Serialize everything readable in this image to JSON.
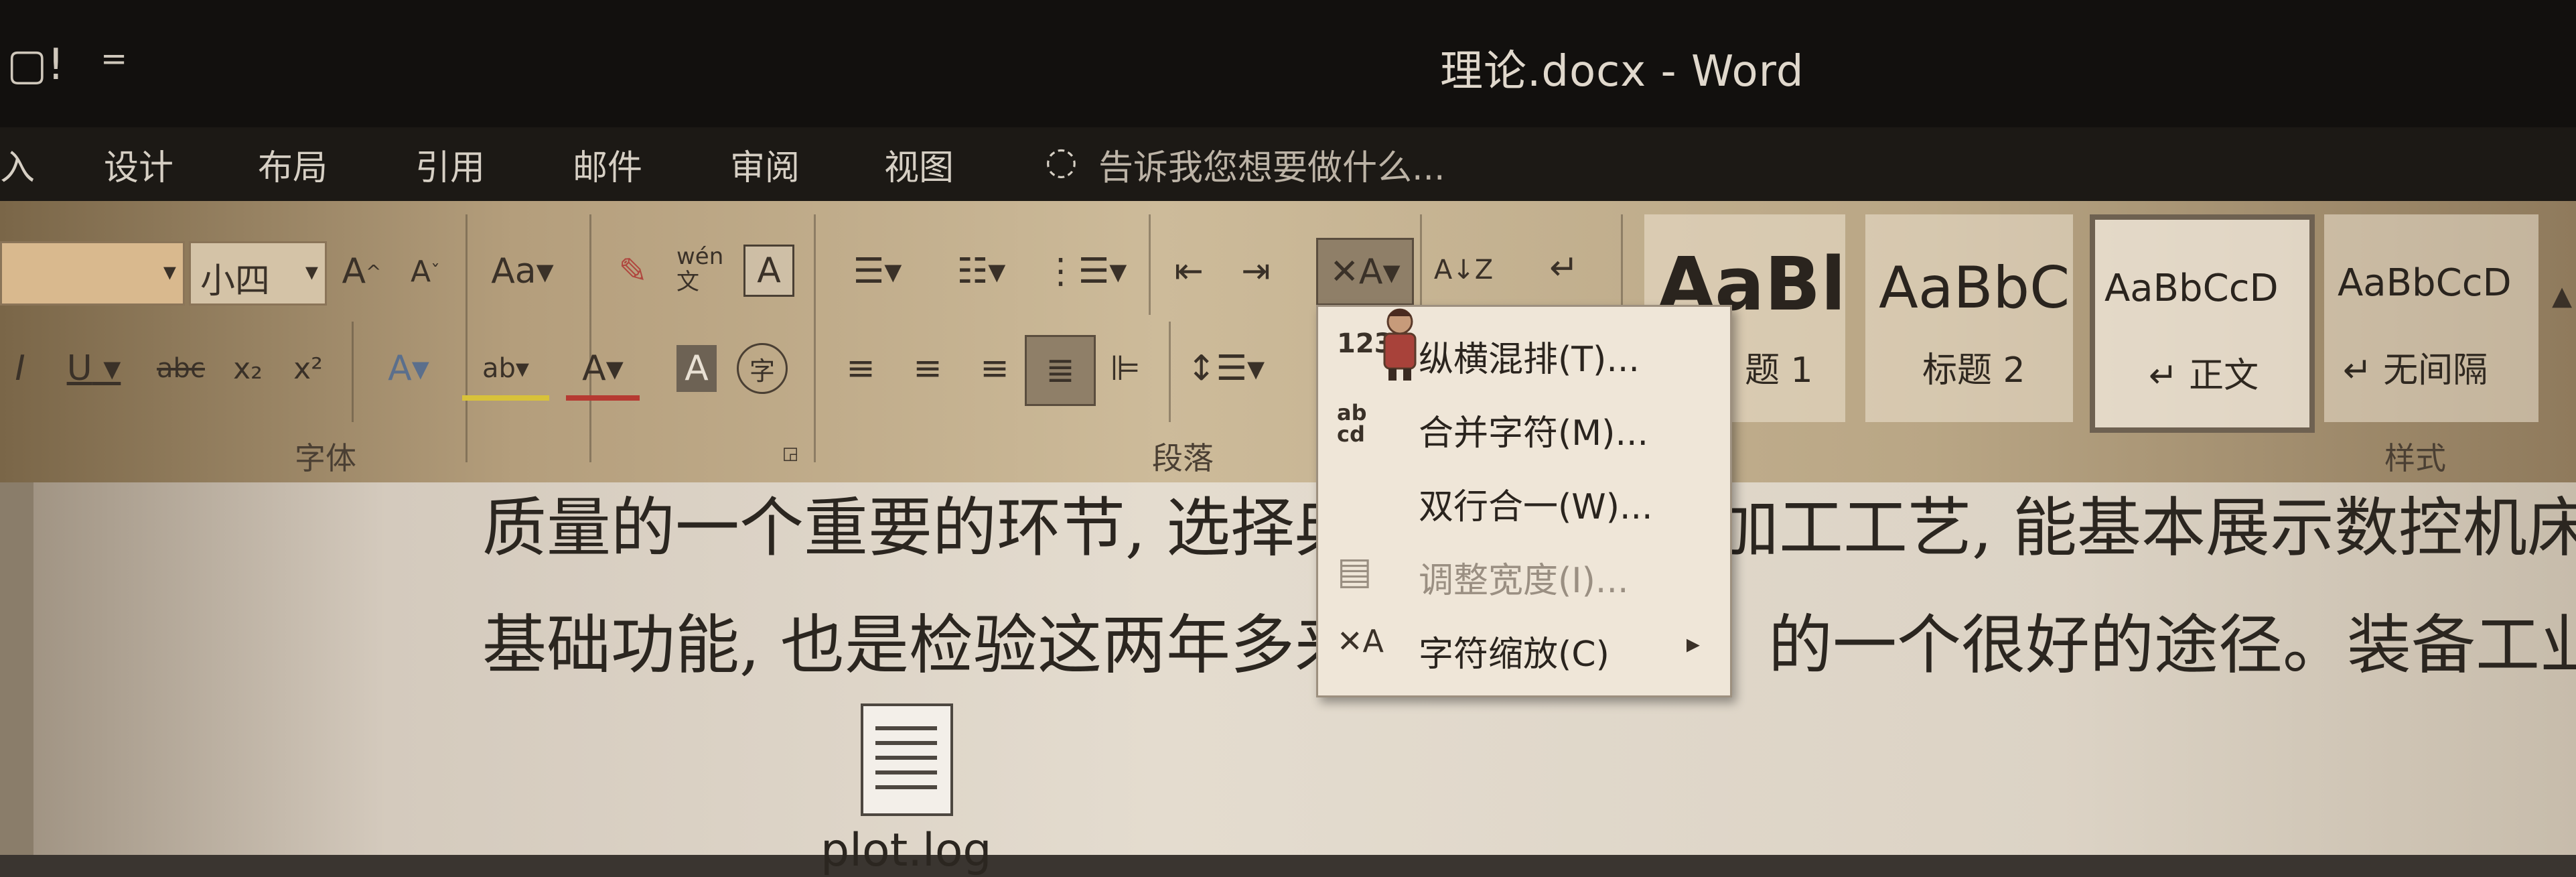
{
  "titlebar": {
    "title": "理论.docx - Word",
    "qa_icons": [
      "▢!",
      "="
    ]
  },
  "menubar": {
    "tabs": [
      "入",
      "设计",
      "布局",
      "引用",
      "邮件",
      "审阅",
      "视图"
    ],
    "tell_me": "告诉我您想要做什么..."
  },
  "ribbon": {
    "font_size_value": "小四",
    "font_group_label": "字体",
    "paragraph_group_label": "段落",
    "styles_group_label": "样式",
    "buttons": {
      "grow_font": "A",
      "shrink_font": "A",
      "change_case": "Aa",
      "phonetic_guide": "wén文",
      "char_border": "A",
      "italic": "I",
      "underline": "U",
      "strikethrough": "abc",
      "subscript": "x₂",
      "superscript": "x²",
      "text_effects": "A",
      "highlight": "ab",
      "font_color": "A",
      "char_shading": "A",
      "enclose_char": "字",
      "sort": "A↓Z",
      "show_marks": "↵"
    },
    "styles": [
      {
        "preview": "AaBl",
        "name": "题 1"
      },
      {
        "preview": "AaBbC",
        "name": "标题 2"
      },
      {
        "preview": "AaBbCcD",
        "name": "↵ 正文"
      },
      {
        "preview": "AaBbCcD",
        "name": "↵ 无间隔"
      }
    ]
  },
  "dropdown_menu": {
    "items": [
      {
        "icon": "123",
        "label": "纵横混排(T)...",
        "disabled": false
      },
      {
        "icon": "ab cd",
        "label": "合并字符(M)...",
        "disabled": false
      },
      {
        "icon": "",
        "label": "双行合一(W)...",
        "disabled": false
      },
      {
        "icon": "▤",
        "label": "调整宽度(I)...",
        "disabled": true
      },
      {
        "icon": "✕A",
        "label": "字符缩放(C)",
        "disabled": false,
        "submenu": true
      }
    ]
  },
  "document": {
    "lines": [
      "质量的一个重要的环节, 选择典",
      "加工工艺, 能基本展示数控机床",
      "基础功能, 也是检验这两年多来",
      "的一个很好的途径。装备工业的"
    ],
    "attachment_label": "plot.log"
  },
  "colors": {
    "titlebar": "#12100e",
    "menubar": "#1c1915",
    "menu_bg": "#efe6d8",
    "text": "#2b2620"
  }
}
